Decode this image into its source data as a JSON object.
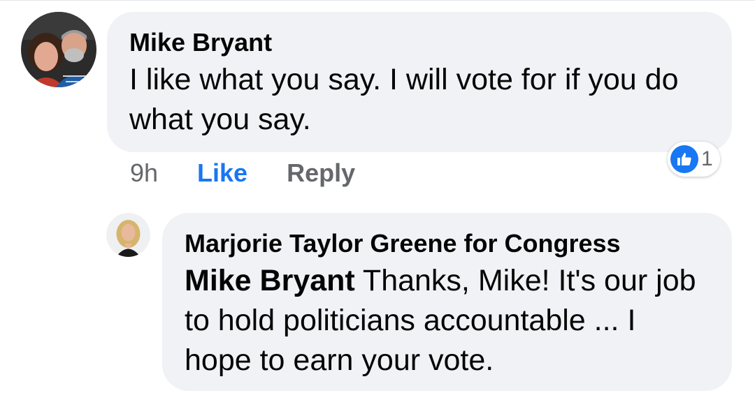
{
  "comment": {
    "author": "Mike Bryant",
    "text": "I like what you say. I will vote for if you do what you say.",
    "time": "9h",
    "like_label": "Like",
    "reply_label": "Reply",
    "reaction_count": "1",
    "avatar_icon": "couple-photo-avatar",
    "reaction_icon": "thumbs-up-icon"
  },
  "reply": {
    "author": "Marjorie Taylor Greene for Congress",
    "mention": "Mike Bryant",
    "text": "Thanks, Mike! It's our job to hold politicians accountable ... I hope to earn your vote.",
    "avatar_icon": "woman-photo-avatar"
  },
  "colors": {
    "bubble": "#f0f2f5",
    "like_blue": "#1877f2",
    "meta_gray": "#65676b"
  }
}
